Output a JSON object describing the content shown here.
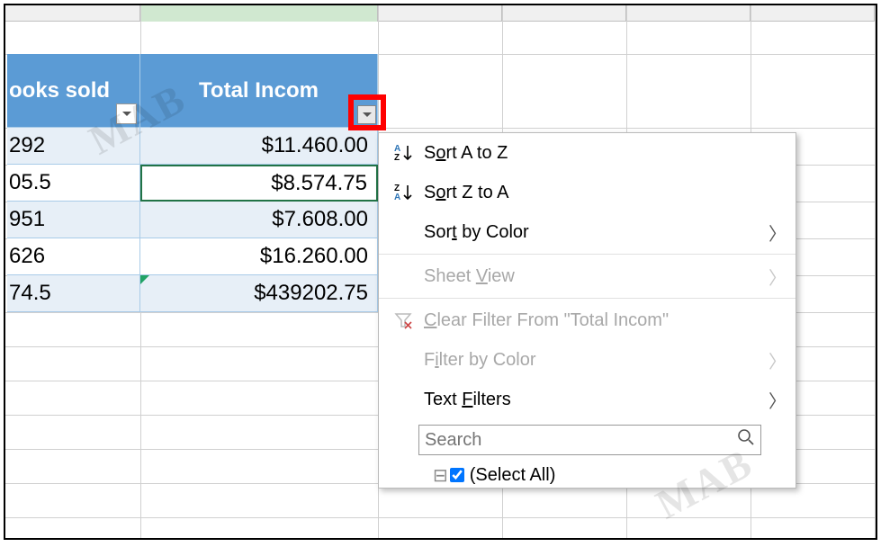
{
  "headers": {
    "col1": "ooks sold",
    "col2": "Total Incom"
  },
  "rows": [
    {
      "a": "292",
      "b": "$11.460.00"
    },
    {
      "a": "05.5",
      "b": "$8.574.75"
    },
    {
      "a": "951",
      "b": "$7.608.00"
    },
    {
      "a": "626",
      "b": "$16.260.00"
    },
    {
      "a": "74.5",
      "b": "$439202.75"
    }
  ],
  "menu": {
    "sort_atoz_pre": "S",
    "sort_atoz_u": "o",
    "sort_atoz_post": "rt A to Z",
    "sort_ztoa_pre": "S",
    "sort_ztoa_u": "o",
    "sort_ztoa_post": "rt Z to A",
    "sort_by_color_pre": "Sor",
    "sort_by_color_u": "t",
    "sort_by_color_post": " by Color",
    "sheet_view_pre": "Sheet ",
    "sheet_view_u": "V",
    "sheet_view_post": "iew",
    "clear_filter_pre": "",
    "clear_filter_u": "C",
    "clear_filter_post": "lear Filter From \"Total Incom\"",
    "filter_by_color_pre": "F",
    "filter_by_color_u": "i",
    "filter_by_color_post": "lter by Color",
    "text_filters_pre": "Text ",
    "text_filters_u": "F",
    "text_filters_post": "ilters",
    "search_placeholder": "Search",
    "select_all": "(Select All)"
  },
  "watermark": "MAB"
}
